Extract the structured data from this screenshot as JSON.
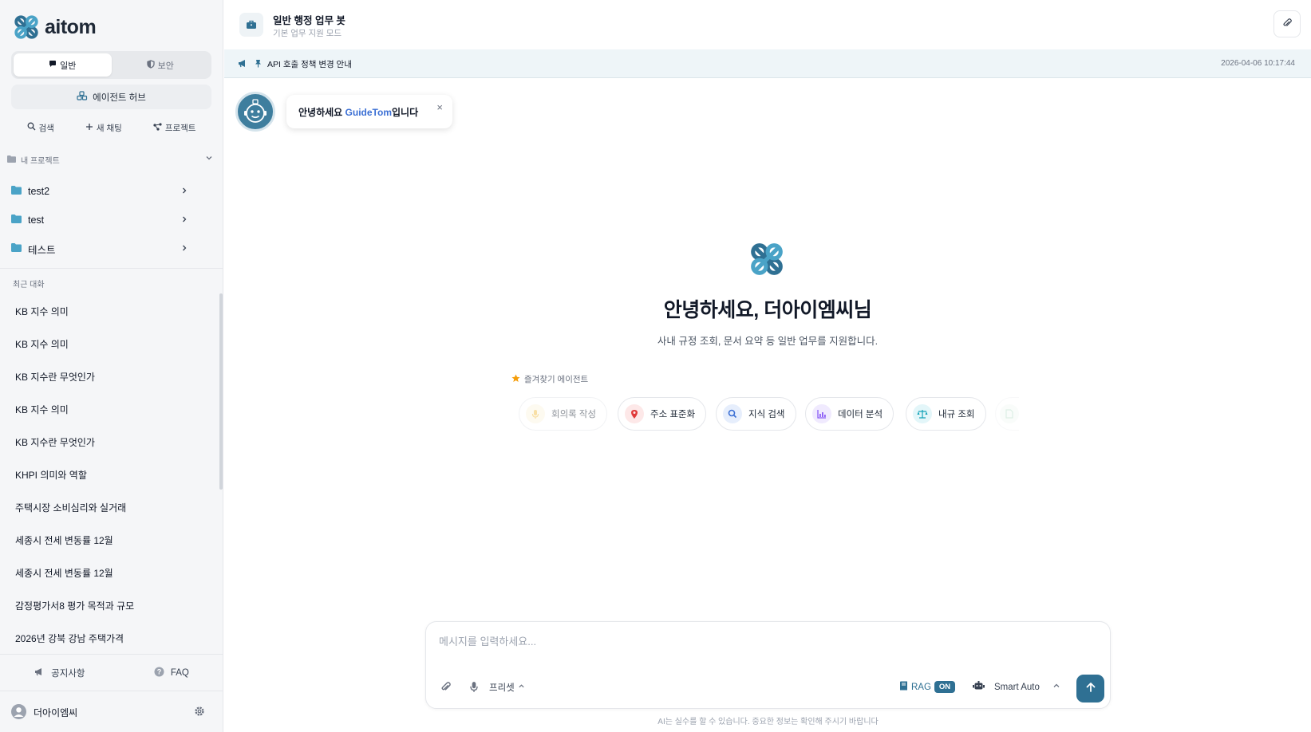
{
  "brand": {
    "name": "aitom",
    "accent": "#2f7093"
  },
  "sidebar": {
    "mode_tabs": [
      {
        "label": "일반",
        "icon": "chat-bubble-icon",
        "active": true
      },
      {
        "label": "보안",
        "icon": "shield-icon",
        "active": false
      }
    ],
    "hub_label": "에이전트 허브",
    "quick_actions": [
      {
        "label": "검색",
        "icon": "search-icon"
      },
      {
        "label": "새 채팅",
        "icon": "plus-icon"
      },
      {
        "label": "프로젝트",
        "icon": "share-nodes-icon"
      }
    ],
    "projects_label": "내 프로젝트",
    "projects": [
      {
        "name": "test2"
      },
      {
        "name": "test"
      },
      {
        "name": "테스트"
      }
    ],
    "recent_label": "최근 대화",
    "recent": [
      "KB 지수 의미",
      "KB 지수 의미",
      "KB 지수란 무엇인가",
      "KB 지수 의미",
      "KB 지수란 무엇인가",
      "KHPI 의미와 역할",
      "주택시장 소비심리와 실거래",
      "세종시 전세 변동률 12월",
      "세종시 전세 변동률 12월",
      "감정평가서8 평가 목적과 규모",
      "2026년 강북 강남 주택가격"
    ],
    "footer": {
      "notice_label": "공지사항",
      "faq_label": "FAQ"
    },
    "user": {
      "name": "더아이엠씨"
    }
  },
  "header": {
    "title": "일반 행정 업무 봇",
    "subtitle": "기본 업무 지원 모드"
  },
  "notice": {
    "text": "API 호출 정책 변경 안내",
    "timestamp": "2026-04-06 10:17:44"
  },
  "guide": {
    "greeting_prefix": "안녕하세요 ",
    "brand_name": "GuideTom",
    "greeting_suffix": "입니다",
    "close": "×"
  },
  "hero": {
    "title": "안녕하세요, 더아이엠씨님",
    "subtitle": "사내 규정 조회, 문서 요약 등 일반 업무를 지원합니다."
  },
  "favorites": {
    "label": "즐겨찾기 에이전트",
    "agents": [
      {
        "label": "회의록 작성",
        "icon": "microphone-icon",
        "color": "#f2c14e",
        "bg": "#fdf6e3"
      },
      {
        "label": "주소 표준화",
        "icon": "map-pin-icon",
        "color": "#e03a3a",
        "bg": "#fde8e8"
      },
      {
        "label": "지식 검색",
        "icon": "search-icon",
        "color": "#3b6fd4",
        "bg": "#e6eefc"
      },
      {
        "label": "데이터 분석",
        "icon": "bar-chart-icon",
        "color": "#8b5cf6",
        "bg": "#f0eafe"
      },
      {
        "label": "내규 조회",
        "icon": "scales-icon",
        "color": "#14a3b8",
        "bg": "#e3f6f9"
      },
      {
        "label": "",
        "icon": "document-icon",
        "color": "#7bc29a",
        "bg": "#eaf6ef"
      }
    ]
  },
  "composer": {
    "placeholder": "메시지를 입력하세요...",
    "preset_label": "프리셋",
    "rag_label": "RAG",
    "rag_state": "ON",
    "model_label": "Smart Auto"
  },
  "disclaimer": "AI는 실수를 할 수 있습니다. 중요한 정보는 확인해 주시기 바랍니다"
}
